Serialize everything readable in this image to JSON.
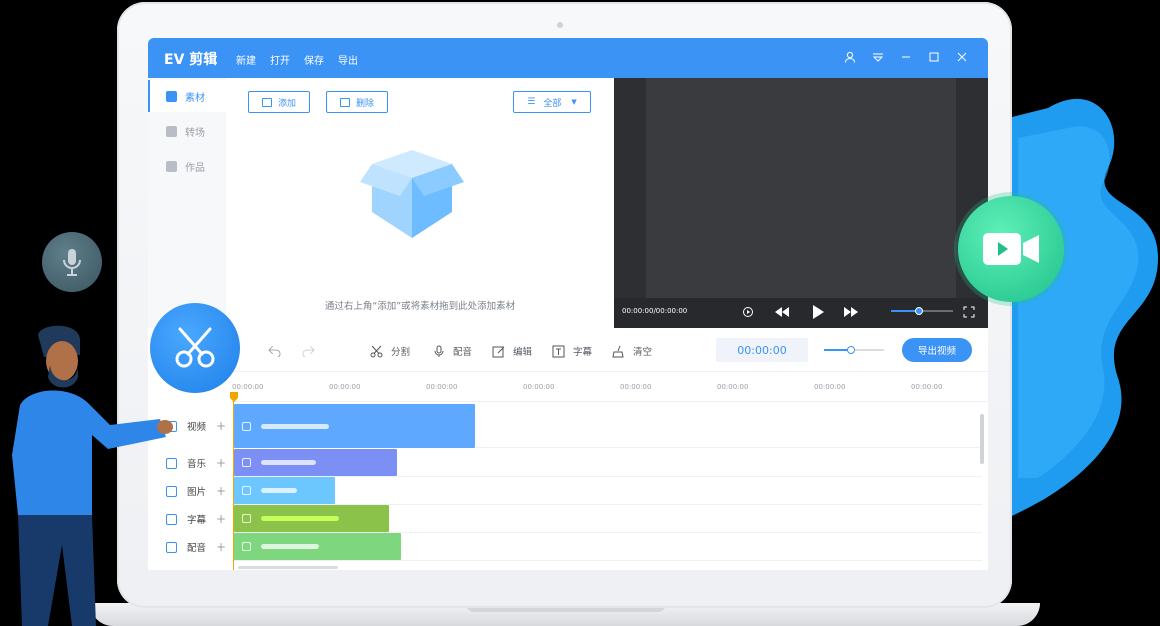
{
  "app": {
    "title": "EV 剪辑",
    "menu": [
      "新建",
      "打开",
      "保存",
      "导出"
    ]
  },
  "sidebar": {
    "items": [
      {
        "label": "素材",
        "active": true
      },
      {
        "label": "转场",
        "active": false
      },
      {
        "label": "作品",
        "active": false
      }
    ]
  },
  "media": {
    "add_label": "添加",
    "delete_label": "删除",
    "filter_label": "全部",
    "empty_hint": "通过右上角“添加”或将素材拖到此处添加素材"
  },
  "preview": {
    "timecode": "00:00:00/00:00:00",
    "volume_level": 0.45
  },
  "toolbar": {
    "split": "分割",
    "dub": "配音",
    "edit": "编辑",
    "subtitle": "字幕",
    "clear": "清空",
    "timecode": "00:00:00",
    "export": "导出视频"
  },
  "timeline": {
    "ticks": [
      "00:00:00",
      "00:00:00",
      "00:00:00",
      "00:00:00",
      "00:00:00",
      "00:00:00",
      "00:00:00",
      "00:00:00"
    ],
    "tracks": [
      {
        "label": "视频",
        "color": "#5fa8ff"
      },
      {
        "label": "音乐",
        "color": "#7b8ff5"
      },
      {
        "label": "图片",
        "color": "#6cc6ff"
      },
      {
        "label": "字幕",
        "color": "#8bc34a"
      },
      {
        "label": "配音",
        "color": "#7ed67e"
      }
    ]
  },
  "colors": {
    "accent": "#3c93f6",
    "playhead": "#f0a500",
    "camera_badge": "#1fc08a"
  }
}
